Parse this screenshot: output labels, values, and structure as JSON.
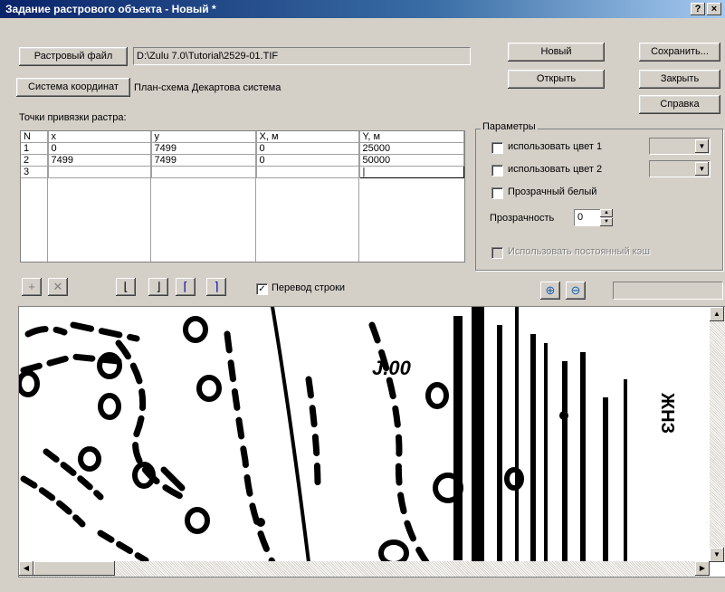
{
  "window": {
    "title": "Задание растрового объекта - Новый *",
    "help_btn": "?",
    "close_btn": "×"
  },
  "raster_file": {
    "button": "Растровый файл",
    "path": "D:\\Zulu 7.0\\Tutorial\\2529-01.TIF"
  },
  "coord_system": {
    "button": "Система координат",
    "value": "План-схема Декартова система"
  },
  "actions": {
    "new": "Новый",
    "save": "Сохранить...",
    "open": "Открыть",
    "close": "Закрыть",
    "help": "Справка"
  },
  "points": {
    "label": "Точки привязки растра:",
    "columns": [
      "N",
      "x",
      "y",
      "X, м",
      "Y, м"
    ],
    "rows": [
      [
        "1",
        "0",
        "7499",
        "0",
        "25000"
      ],
      [
        "2",
        "7499",
        "7499",
        "0",
        "50000"
      ],
      [
        "3",
        "",
        "",
        "",
        ""
      ]
    ]
  },
  "params": {
    "title": "Параметры",
    "use_color1": "использовать цвет 1",
    "use_color2": "использовать цвет 2",
    "transparent_white": "Прозрачный белый",
    "transparency_label": "Прозрачность",
    "transparency_value": "0",
    "persistent_cache": "Использовать постоянный кэш"
  },
  "toolbar": {
    "line_wrap": "Перевод строки",
    "line_wrap_checked": true
  },
  "map_text": {
    "label1": "J.00",
    "label2": "ЖНЗ"
  }
}
